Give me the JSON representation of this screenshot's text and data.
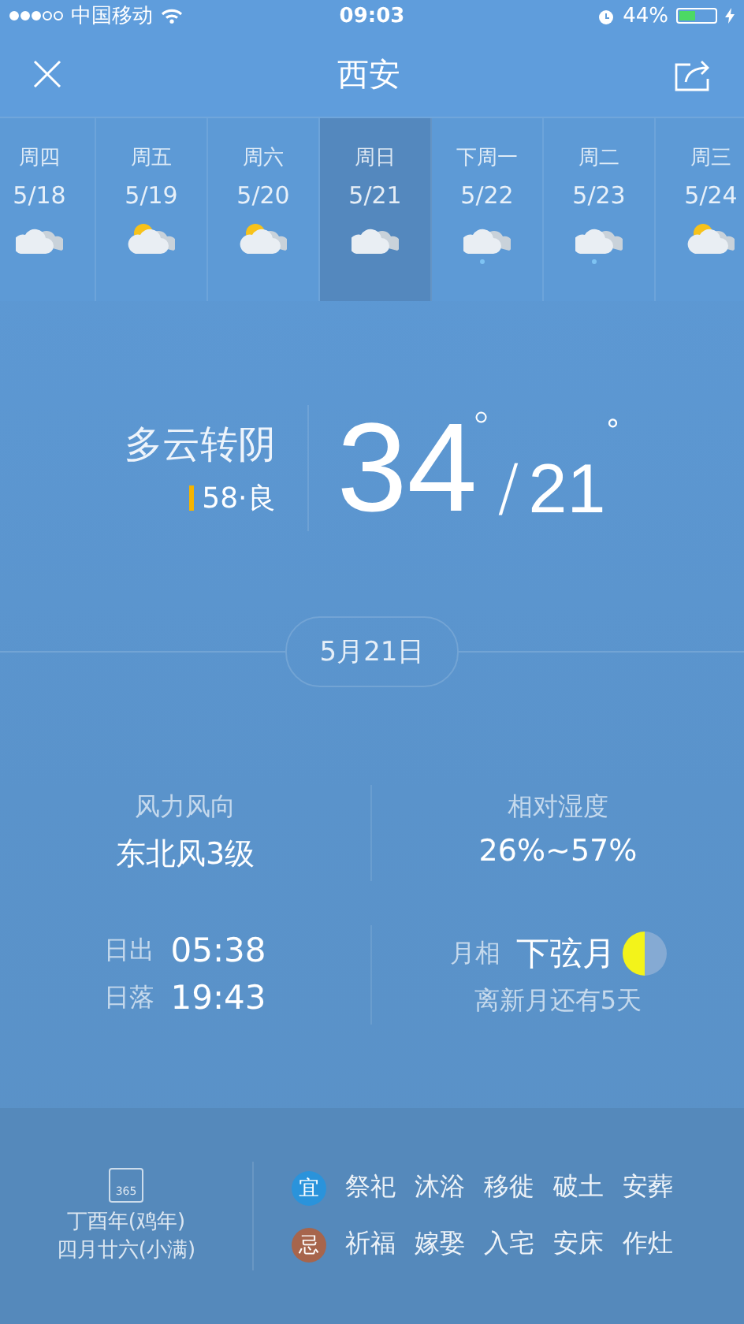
{
  "status_bar": {
    "carrier": "中国移动",
    "time": "09:03",
    "battery_text": "44%",
    "battery": {
      "level": 0.44
    }
  },
  "header": {
    "title": "西安"
  },
  "days": [
    {
      "weekday": "周四",
      "date": "5/18",
      "kind": "cloudy",
      "selected": false
    },
    {
      "weekday": "周五",
      "date": "5/19",
      "kind": "partly",
      "selected": false
    },
    {
      "weekday": "周六",
      "date": "5/20",
      "kind": "partly",
      "selected": false
    },
    {
      "weekday": "周日",
      "date": "5/21",
      "kind": "cloudy",
      "selected": true
    },
    {
      "weekday": "下周一",
      "date": "5/22",
      "kind": "rain",
      "selected": false
    },
    {
      "weekday": "周二",
      "date": "5/23",
      "kind": "rain",
      "selected": false
    },
    {
      "weekday": "周三",
      "date": "5/24",
      "kind": "partly",
      "selected": false
    }
  ],
  "current": {
    "condition": "多云转阴",
    "aqi": "58·良",
    "high": "34",
    "high_unit": "°",
    "slash": "/",
    "low": "21",
    "low_unit": "°"
  },
  "date_pill": "5月21日",
  "details": [
    {
      "label": "风力风向",
      "value": "东北风3级"
    },
    {
      "label": "相对湿度",
      "value": "26%~57%"
    }
  ],
  "sun": [
    {
      "label": "日出",
      "value": "05:38"
    },
    {
      "label": "日落",
      "value": "19:43"
    }
  ],
  "moon": {
    "label": "月相",
    "phase": "下弦月",
    "note": "离新月还有5天"
  },
  "almanac": {
    "calendar_icon_text": "365",
    "year": "丁酉年(鸡年)",
    "lunar_date": "四月廿六(小满)",
    "rows": [
      {
        "badge": "宜",
        "color": "#2a93db",
        "items": [
          "祭祀",
          "沐浴",
          "移徙",
          "破土",
          "安葬"
        ]
      },
      {
        "badge": "忌",
        "color": "#a7654c",
        "items": [
          "祈福",
          "嫁娶",
          "入宅",
          "安床",
          "作灶"
        ]
      }
    ]
  }
}
